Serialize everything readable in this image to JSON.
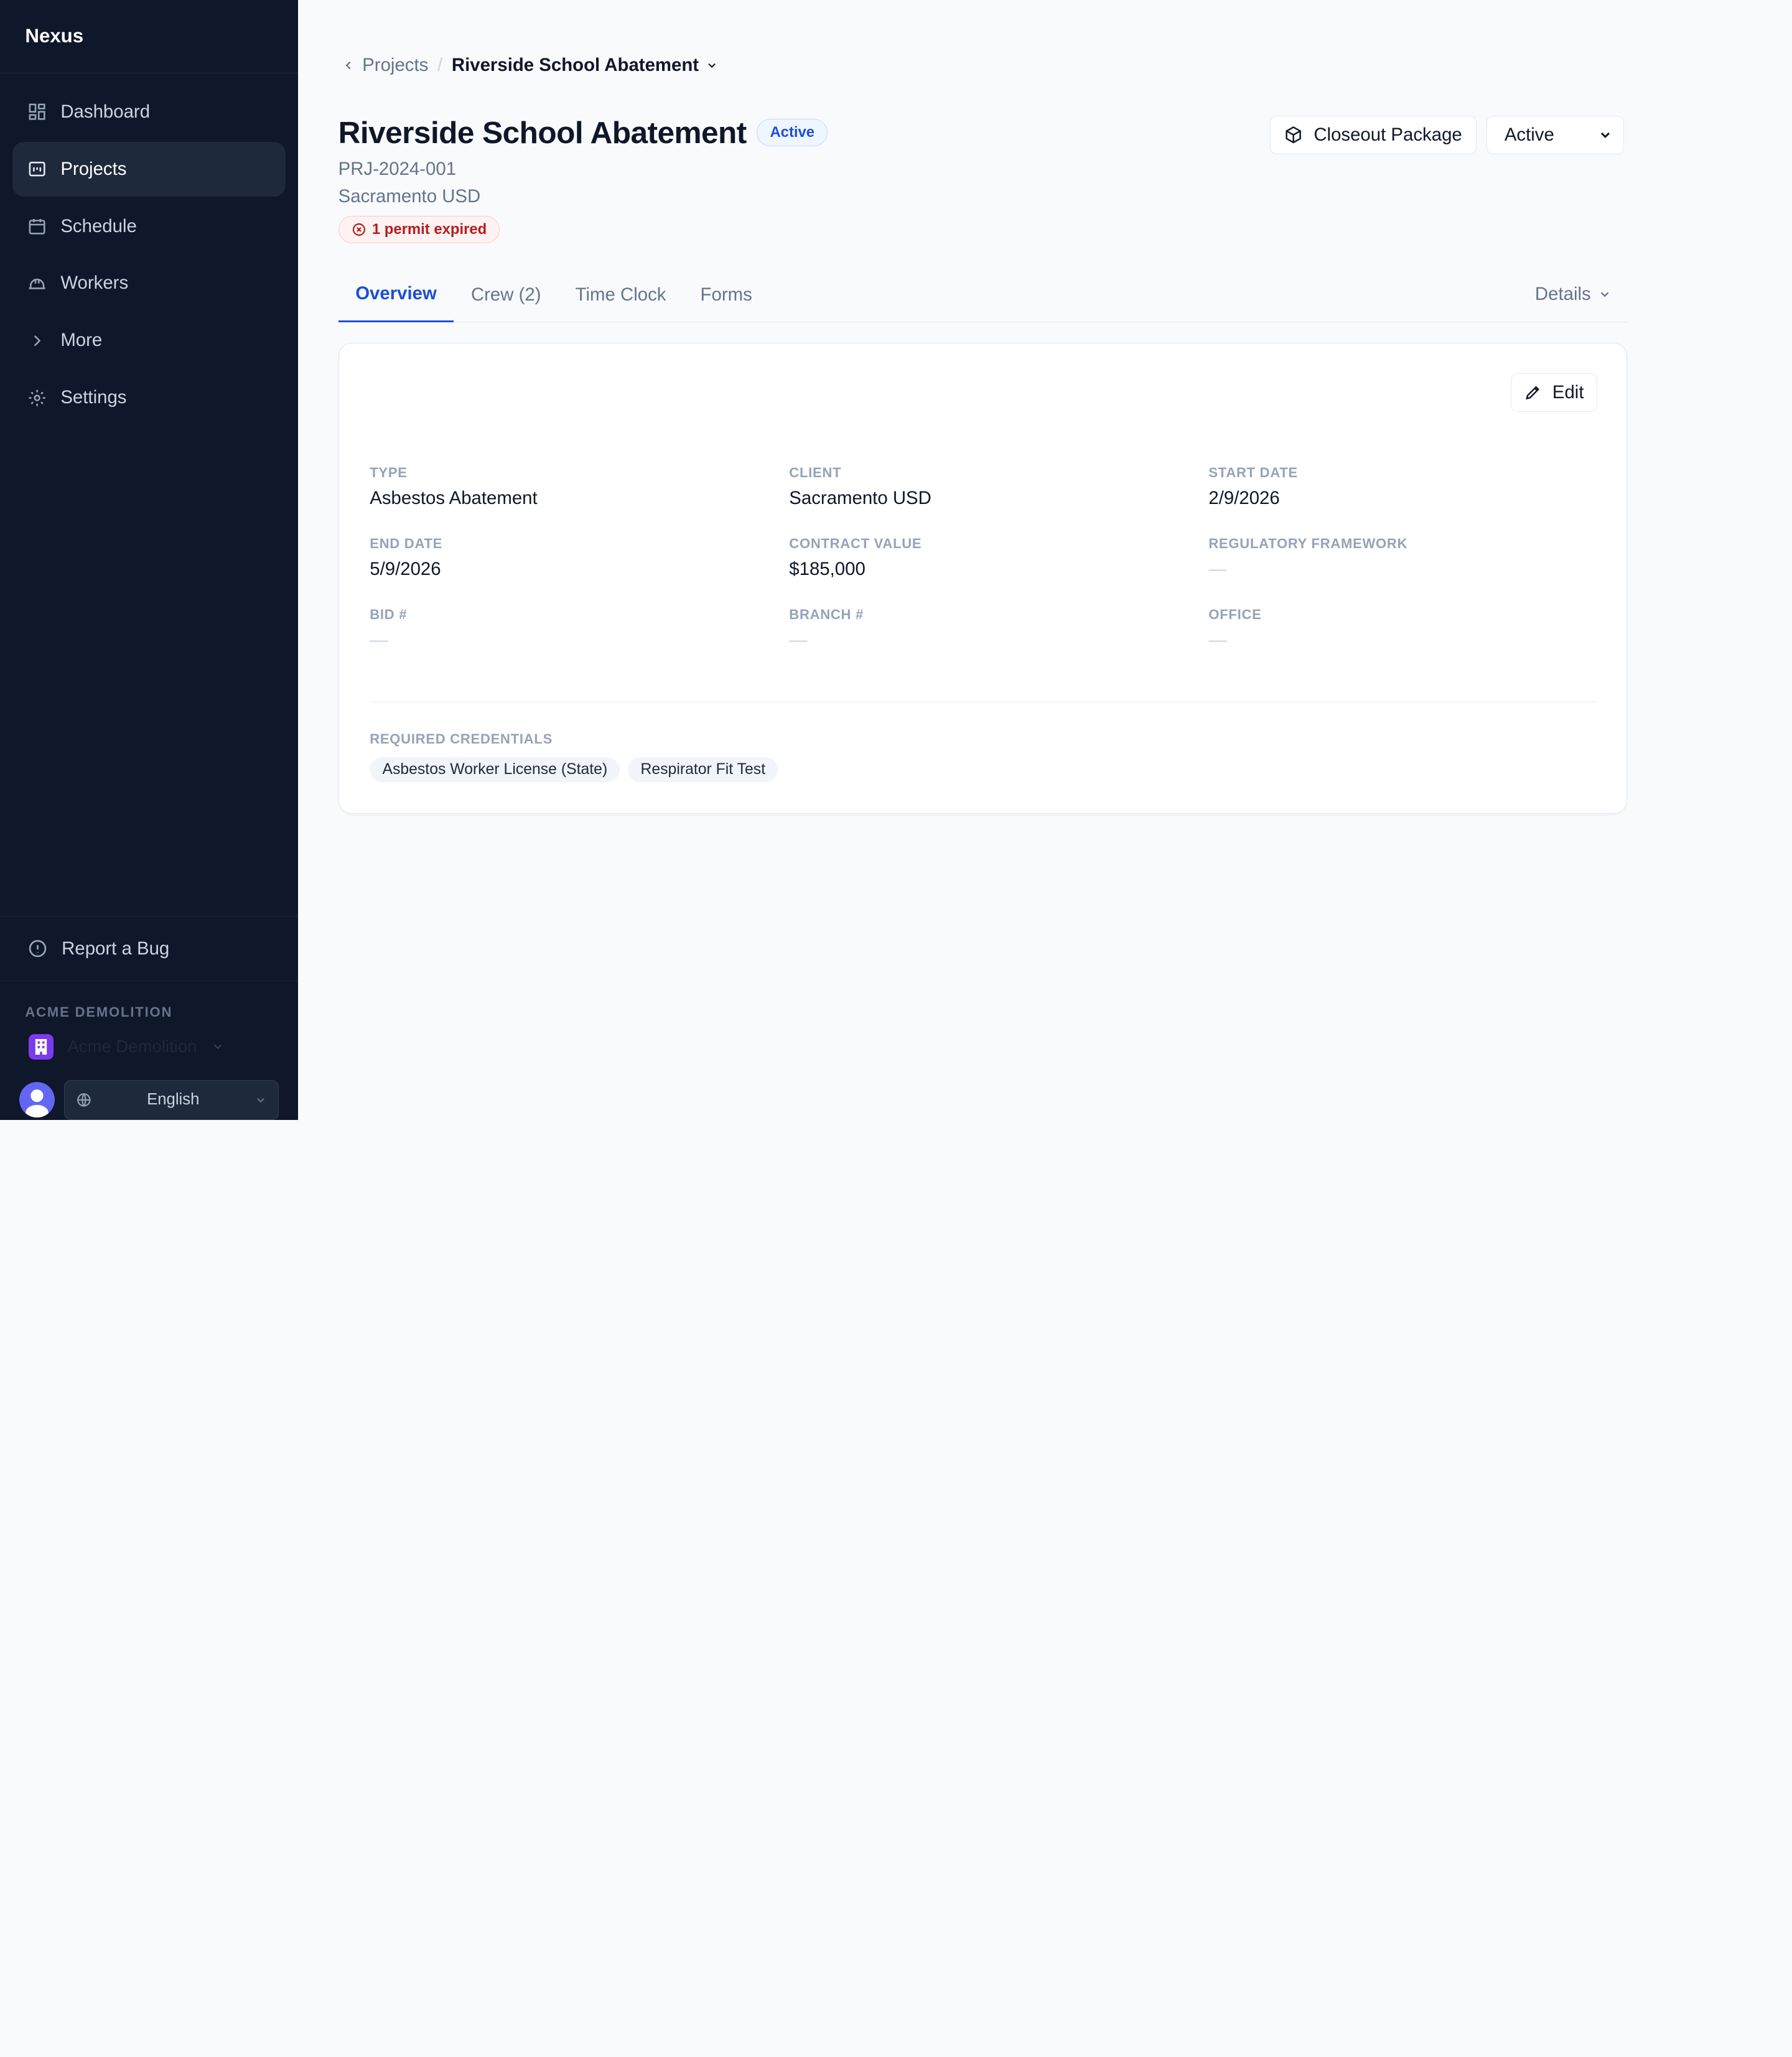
{
  "sidebar": {
    "brand": "Nexus",
    "items": [
      {
        "label": "Dashboard",
        "icon": "dashboard-icon"
      },
      {
        "label": "Projects",
        "icon": "projects-icon"
      },
      {
        "label": "Schedule",
        "icon": "calendar-icon"
      },
      {
        "label": "Workers",
        "icon": "hard-hat-icon"
      },
      {
        "label": "More",
        "icon": "chevron-right-icon"
      },
      {
        "label": "Settings",
        "icon": "gear-icon"
      }
    ],
    "active_item": "Projects",
    "report_bug": "Report a Bug",
    "org_label": "ACME DEMOLITION",
    "org_name": "Acme Demolition",
    "language": "English"
  },
  "breadcrumb": {
    "parent": "Projects",
    "current": "Riverside School Abatement"
  },
  "project": {
    "title": "Riverside School Abatement",
    "status_badge": "Active",
    "code": "PRJ-2024-001",
    "client_line": "Sacramento USD",
    "permit_alert": "1 permit expired"
  },
  "actions": {
    "closeout": "Closeout Package",
    "status_select": "Active"
  },
  "tabs": [
    {
      "label": "Overview",
      "active": true
    },
    {
      "label": "Crew (2)",
      "active": false
    },
    {
      "label": "Time Clock",
      "active": false
    },
    {
      "label": "Forms",
      "active": false
    }
  ],
  "details_label": "Details",
  "card": {
    "edit_label": "Edit",
    "fields": [
      {
        "label": "TYPE",
        "value": "Asbestos Abatement"
      },
      {
        "label": "CLIENT",
        "value": "Sacramento USD"
      },
      {
        "label": "START DATE",
        "value": "2/9/2026"
      },
      {
        "label": "END DATE",
        "value": "5/9/2026"
      },
      {
        "label": "CONTRACT VALUE",
        "value": "$185,000"
      },
      {
        "label": "REGULATORY FRAMEWORK",
        "value": "—"
      },
      {
        "label": "BID #",
        "value": "—"
      },
      {
        "label": "BRANCH #",
        "value": "—"
      },
      {
        "label": "OFFICE",
        "value": "—"
      }
    ],
    "credentials_label": "REQUIRED CREDENTIALS",
    "credentials": [
      "Asbestos Worker License (State)",
      "Respirator Fit Test"
    ]
  },
  "colors": {
    "sidebar_bg": "#0f172a",
    "accent": "#1d4ed8",
    "danger": "#b91c1c",
    "org_logo": "#7c3aed",
    "avatar": "#6366f1"
  }
}
